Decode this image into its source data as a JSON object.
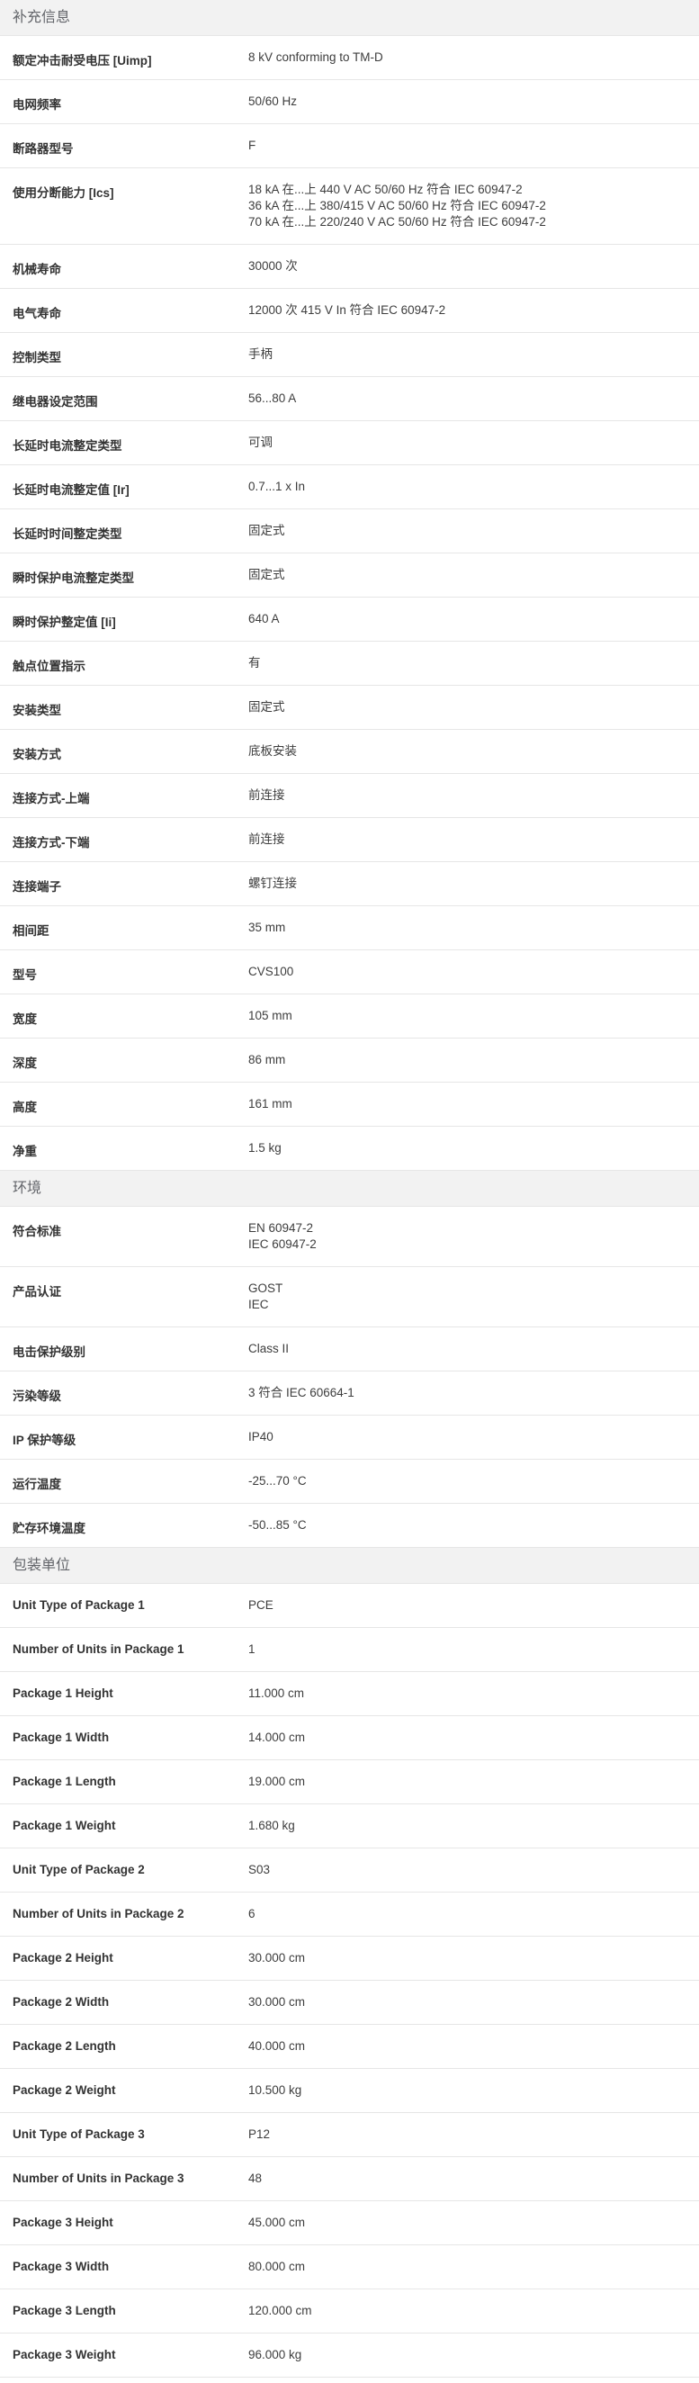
{
  "sections": [
    {
      "title": "补充信息",
      "rows": [
        {
          "label": "额定冲击耐受电压 [Uimp]",
          "values": [
            "8 kV conforming to TM-D"
          ]
        },
        {
          "label": "电网频率",
          "values": [
            "50/60 Hz"
          ]
        },
        {
          "label": "断路器型号",
          "values": [
            "F"
          ]
        },
        {
          "label": "使用分断能力 [Ics]",
          "values": [
            "18 kA 在...上 440 V AC 50/60 Hz 符合 IEC 60947-2",
            "36 kA 在...上 380/415 V AC 50/60 Hz 符合 IEC 60947-2",
            "70 kA 在...上 220/240 V AC 50/60 Hz 符合 IEC 60947-2"
          ]
        },
        {
          "label": "机械寿命",
          "values": [
            "30000 次"
          ]
        },
        {
          "label": "电气寿命",
          "values": [
            "12000 次 415 V In 符合 IEC 60947-2"
          ]
        },
        {
          "label": "控制类型",
          "values": [
            "手柄"
          ]
        },
        {
          "label": "继电器设定范围",
          "values": [
            "56...80 A"
          ]
        },
        {
          "label": "长延时电流整定类型",
          "values": [
            "可调"
          ]
        },
        {
          "label": "长延时电流整定值 [Ir]",
          "values": [
            "0.7...1 x In"
          ]
        },
        {
          "label": "长延时时间整定类型",
          "values": [
            "固定式"
          ]
        },
        {
          "label": "瞬时保护电流整定类型",
          "values": [
            "固定式"
          ]
        },
        {
          "label": "瞬时保护整定值 [Ii]",
          "values": [
            "640 A"
          ]
        },
        {
          "label": "触点位置指示",
          "values": [
            "有"
          ]
        },
        {
          "label": "安装类型",
          "values": [
            "固定式"
          ]
        },
        {
          "label": "安装方式",
          "values": [
            "底板安装"
          ]
        },
        {
          "label": "连接方式-上端",
          "values": [
            "前连接"
          ]
        },
        {
          "label": "连接方式-下端",
          "values": [
            "前连接"
          ]
        },
        {
          "label": "连接端子",
          "values": [
            "螺钉连接"
          ]
        },
        {
          "label": "相间距",
          "values": [
            "35 mm"
          ]
        },
        {
          "label": "型号",
          "values": [
            "CVS100"
          ]
        },
        {
          "label": "宽度",
          "values": [
            "105 mm"
          ]
        },
        {
          "label": "深度",
          "values": [
            "86 mm"
          ]
        },
        {
          "label": "高度",
          "values": [
            "161 mm"
          ]
        },
        {
          "label": "净重",
          "values": [
            "1.5 kg"
          ]
        }
      ]
    },
    {
      "title": "环境",
      "rows": [
        {
          "label": "符合标准",
          "values": [
            "EN 60947-2",
            "IEC 60947-2"
          ]
        },
        {
          "label": "产品认证",
          "values": [
            "GOST",
            "IEC"
          ]
        },
        {
          "label": "电击保护级别",
          "values": [
            "Class II"
          ]
        },
        {
          "label": "污染等级",
          "values": [
            "3 符合 IEC 60664-1"
          ]
        },
        {
          "label": "IP 保护等级",
          "values": [
            "IP40"
          ]
        },
        {
          "label": "运行温度",
          "values": [
            "-25...70 °C"
          ]
        },
        {
          "label": "贮存环境温度",
          "values": [
            "-50...85 °C"
          ]
        }
      ]
    },
    {
      "title": "包装单位",
      "rows": [
        {
          "label": "Unit Type of Package 1",
          "values": [
            "PCE"
          ]
        },
        {
          "label": "Number of Units in Package 1",
          "values": [
            "1"
          ]
        },
        {
          "label": "Package 1 Height",
          "values": [
            "11.000 cm"
          ]
        },
        {
          "label": "Package 1 Width",
          "values": [
            "14.000 cm"
          ]
        },
        {
          "label": "Package 1 Length",
          "values": [
            "19.000 cm"
          ]
        },
        {
          "label": "Package 1 Weight",
          "values": [
            "1.680 kg"
          ]
        },
        {
          "label": "Unit Type of Package 2",
          "values": [
            "S03"
          ]
        },
        {
          "label": "Number of Units in Package 2",
          "values": [
            "6"
          ]
        },
        {
          "label": "Package 2 Height",
          "values": [
            "30.000 cm"
          ]
        },
        {
          "label": "Package 2 Width",
          "values": [
            "30.000 cm"
          ]
        },
        {
          "label": "Package 2 Length",
          "values": [
            "40.000 cm"
          ]
        },
        {
          "label": "Package 2 Weight",
          "values": [
            "10.500 kg"
          ]
        },
        {
          "label": "Unit Type of Package 3",
          "values": [
            "P12"
          ]
        },
        {
          "label": "Number of Units in Package 3",
          "values": [
            "48"
          ]
        },
        {
          "label": "Package 3 Height",
          "values": [
            "45.000 cm"
          ]
        },
        {
          "label": "Package 3 Width",
          "values": [
            "80.000 cm"
          ]
        },
        {
          "label": "Package 3 Length",
          "values": [
            "120.000 cm"
          ]
        },
        {
          "label": "Package 3 Weight",
          "values": [
            "96.000 kg"
          ]
        }
      ]
    }
  ]
}
